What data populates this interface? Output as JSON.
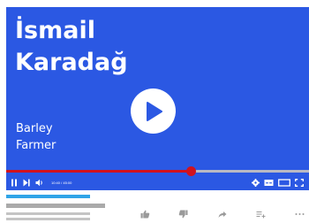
{
  "video": {
    "title_line1": "İsmail",
    "title_line2": "Karadağ",
    "subtitle_line1": "Barley",
    "subtitle_line2": "Farmer",
    "background_color": "#2b58e3",
    "progress_fraction": 0.608,
    "progress_color": "#d1121e",
    "current_time": "10:40 / 45:00"
  },
  "icons": {
    "play": "play-icon",
    "pause": "pause-icon",
    "next": "next-icon",
    "volume": "volume-icon",
    "settings": "settings-icon",
    "subtitles": "subtitles-icon",
    "theater": "theater-icon",
    "fullscreen": "fullscreen-icon",
    "like": "thumbs-up-icon",
    "dislike": "thumbs-down-icon",
    "share": "share-icon",
    "save": "add-to-playlist-icon",
    "more": "more-icon"
  },
  "colors": {
    "accent_bar": "#2fa4e7",
    "placeholder": "#aaaaaa",
    "icon_gray": "#9a9a9a"
  }
}
